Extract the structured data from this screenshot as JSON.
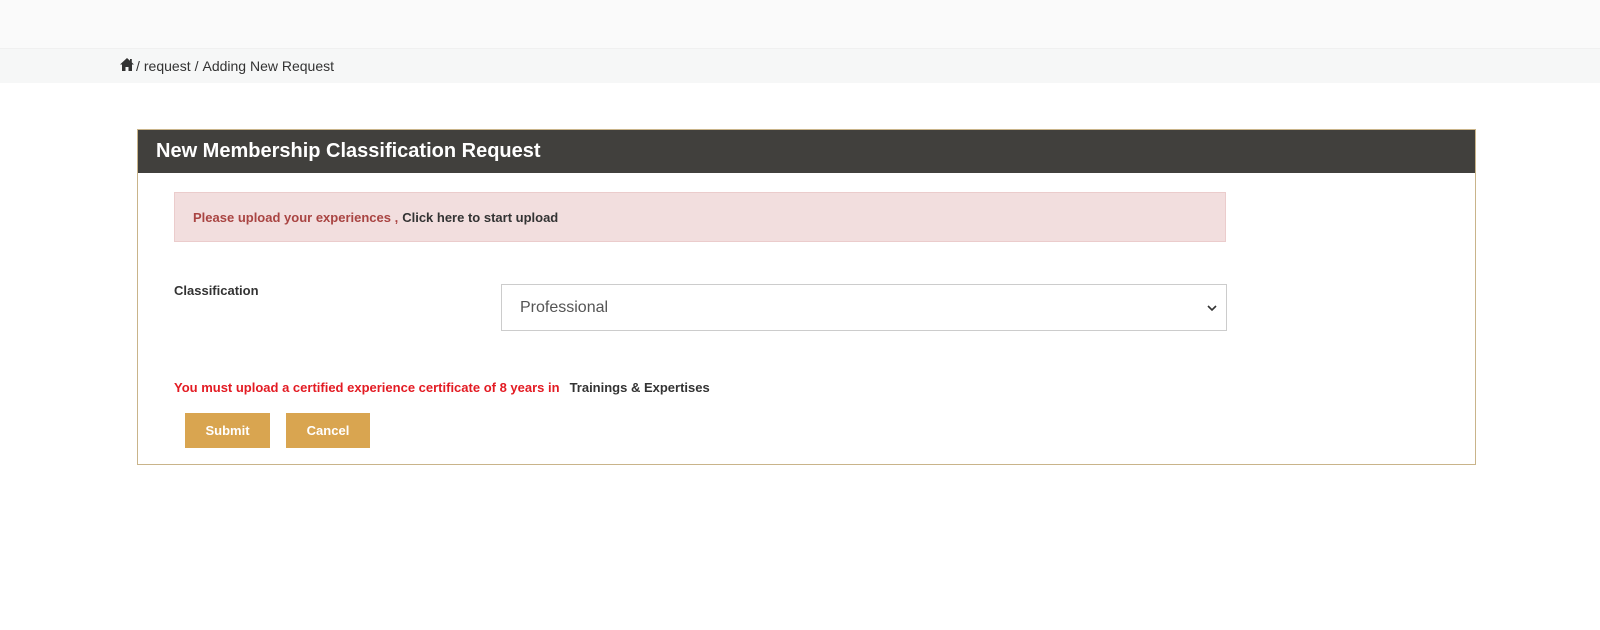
{
  "breadcrumb": {
    "home_icon": "home-icon",
    "items": [
      "request",
      "Adding New Request"
    ],
    "separator": "/"
  },
  "panel": {
    "title": "New Membership Classification Request"
  },
  "alert": {
    "text": "Please upload your experiences ,",
    "link": "Click here to start upload",
    "color": "#a94442",
    "background": "#f2dede"
  },
  "classification": {
    "label": "Classification",
    "selected": "Professional"
  },
  "warning": {
    "text": "You must upload a certified experience certificate of 8 years in",
    "link": "Trainings & Expertises",
    "color": "#e31b23"
  },
  "buttons": {
    "submit": "Submit",
    "cancel": "Cancel",
    "color": "#d9a550"
  },
  "colors": {
    "header_bg": "#41403d",
    "panel_border": "#c9b48a"
  }
}
